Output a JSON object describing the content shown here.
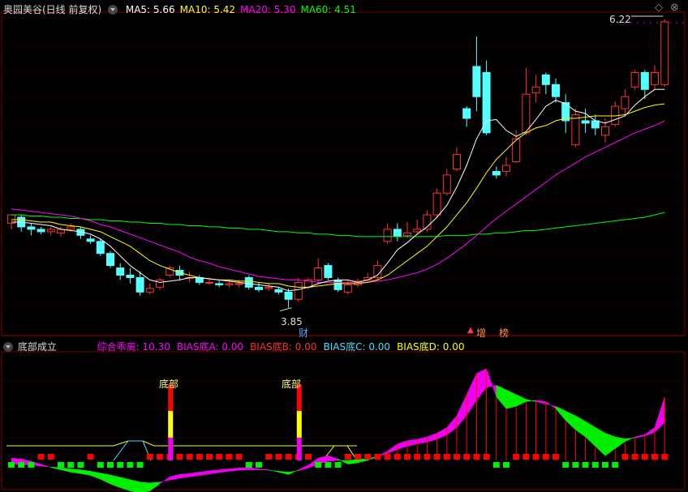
{
  "header": {
    "stock_title": "奥园美谷(日线 前复权)",
    "ma": [
      {
        "label": "MA5: 5.66",
        "color": "#ffffff"
      },
      {
        "label": "MA10: 5.42",
        "color": "#ffff00"
      },
      {
        "label": "MA20: 5.30",
        "color": "#ff00ff"
      },
      {
        "label": "MA60: 4.51",
        "color": "#00ff00"
      }
    ],
    "corner_up": "◇",
    "corner_close": "⊗"
  },
  "price_labels": {
    "high": "6.22",
    "low": "3.85",
    "cai": "财",
    "zeng": "增",
    "rong": "榜"
  },
  "indicator": {
    "title": "底部成立",
    "values": [
      {
        "label": "综合乖离: 10.30",
        "color": "#ff00ff"
      },
      {
        "label": "BIAS底A: 0.00",
        "color": "#ff00ff"
      },
      {
        "label": "BIAS底B: 0.00",
        "color": "#ff3030"
      },
      {
        "label": "BIAS底C: 0.00",
        "color": "#40e0ff"
      },
      {
        "label": "BIAS底D: 0.00",
        "color": "#ffff00"
      }
    ],
    "signal_label": "底部"
  },
  "colors": {
    "up": "#ff3232",
    "down": "#54ffff",
    "ma5": "#ffffff",
    "ma10": "#ffff00",
    "ma20": "#ff00ff",
    "ma60": "#00ff00",
    "grid": "#7a0000",
    "green": "#00ee00",
    "magenta": "#ee00ee",
    "red": "#ff0000",
    "yellow": "#ffff00"
  },
  "chart_data": {
    "type": "candlestick",
    "ylim": [
      3.7,
      6.3
    ],
    "candles": [
      [
        4.55,
        4.62,
        4.58,
        4.5
      ],
      [
        4.6,
        4.52,
        4.62,
        4.48
      ],
      [
        4.52,
        4.5,
        4.55,
        4.45
      ],
      [
        4.5,
        4.48,
        4.52,
        4.46
      ],
      [
        4.48,
        4.5,
        4.52,
        4.45
      ],
      [
        4.47,
        4.5,
        4.52,
        4.44
      ],
      [
        4.5,
        4.52,
        4.55,
        4.48
      ],
      [
        4.5,
        4.45,
        4.52,
        4.42
      ],
      [
        4.42,
        4.4,
        4.45,
        4.38
      ],
      [
        4.4,
        4.3,
        4.42,
        4.28
      ],
      [
        4.3,
        4.2,
        4.32,
        4.18
      ],
      [
        4.18,
        4.12,
        4.22,
        4.08
      ],
      [
        4.12,
        4.1,
        4.18,
        4.05
      ],
      [
        4.1,
        3.98,
        4.15,
        3.95
      ],
      [
        3.98,
        4.01,
        4.05,
        3.96
      ],
      [
        4.02,
        4.08,
        4.1,
        4.0
      ],
      [
        4.12,
        4.18,
        4.2,
        4.1
      ],
      [
        4.16,
        4.12,
        4.2,
        4.08
      ],
      [
        4.1,
        4.1,
        4.15,
        4.06
      ],
      [
        4.1,
        4.06,
        4.12,
        4.04
      ],
      [
        4.06,
        4.06,
        4.1,
        4.04
      ],
      [
        4.05,
        4.04,
        4.08,
        4.02
      ],
      [
        4.04,
        4.05,
        4.08,
        4.02
      ],
      [
        4.05,
        4.05,
        4.08,
        4.02
      ],
      [
        4.1,
        4.02,
        4.12,
        4.0
      ],
      [
        4.02,
        4.0,
        4.06,
        3.98
      ],
      [
        4.01,
        4.02,
        4.05,
        3.99
      ],
      [
        4.0,
        3.98,
        4.02,
        3.96
      ],
      [
        3.98,
        3.92,
        4.01,
        3.85
      ],
      [
        3.92,
        4.06,
        4.1,
        3.9
      ],
      [
        4.02,
        4.08,
        4.1,
        4.0
      ],
      [
        4.08,
        4.18,
        4.26,
        4.05
      ],
      [
        4.2,
        4.1,
        4.22,
        4.08
      ],
      [
        4.08,
        4.0,
        4.1,
        3.98
      ],
      [
        3.98,
        4.04,
        4.08,
        3.96
      ],
      [
        4.04,
        4.07,
        4.09,
        4.02
      ],
      [
        4.08,
        4.1,
        4.14,
        4.06
      ],
      [
        4.1,
        4.2,
        4.24,
        4.08
      ],
      [
        4.4,
        4.5,
        4.55,
        4.38
      ],
      [
        4.5,
        4.44,
        4.55,
        4.4
      ],
      [
        4.45,
        4.47,
        4.56,
        4.43
      ],
      [
        4.48,
        4.5,
        4.58,
        4.46
      ],
      [
        4.5,
        4.62,
        4.66,
        4.48
      ],
      [
        4.62,
        4.8,
        4.84,
        4.6
      ],
      [
        4.8,
        4.95,
        5.0,
        4.78
      ],
      [
        5.0,
        5.12,
        5.18,
        4.98
      ],
      [
        5.5,
        5.42,
        5.52,
        5.35
      ],
      [
        5.85,
        5.6,
        6.1,
        5.48
      ],
      [
        5.8,
        5.3,
        5.9,
        5.28
      ],
      [
        4.98,
        4.95,
        5.02,
        4.92
      ],
      [
        4.98,
        5.03,
        5.1,
        4.94
      ],
      [
        5.06,
        5.25,
        5.32,
        5.05
      ],
      [
        5.3,
        5.62,
        5.84,
        5.28
      ],
      [
        5.63,
        5.68,
        5.78,
        5.55
      ],
      [
        5.78,
        5.7,
        5.8,
        5.62
      ],
      [
        5.7,
        5.6,
        5.75,
        5.55
      ],
      [
        5.55,
        5.4,
        5.62,
        5.3
      ],
      [
        5.2,
        5.45,
        5.5,
        5.18
      ],
      [
        5.4,
        5.38,
        5.5,
        5.3
      ],
      [
        5.4,
        5.34,
        5.45,
        5.28
      ],
      [
        5.28,
        5.35,
        5.42,
        5.22
      ],
      [
        5.37,
        5.52,
        5.56,
        5.35
      ],
      [
        5.5,
        5.6,
        5.66,
        5.45
      ],
      [
        5.68,
        5.8,
        5.82,
        5.66
      ],
      [
        5.8,
        5.66,
        5.82,
        5.58
      ],
      [
        5.7,
        5.8,
        5.86,
        5.66
      ],
      [
        5.7,
        6.22,
        6.24,
        5.68
      ]
    ],
    "ma5": [
      4.56,
      4.56,
      4.55,
      4.54,
      4.53,
      4.5,
      4.49,
      4.48,
      4.46,
      4.42,
      4.36,
      4.28,
      4.2,
      4.14,
      4.08,
      4.06,
      4.07,
      4.08,
      4.1,
      4.1,
      4.09,
      4.08,
      4.07,
      4.06,
      4.05,
      4.04,
      4.03,
      4.02,
      3.99,
      4.0,
      4.02,
      4.05,
      4.07,
      4.08,
      4.08,
      4.06,
      4.08,
      4.12,
      4.22,
      4.33,
      4.39,
      4.46,
      4.52,
      4.6,
      4.7,
      4.85,
      5.03,
      5.25,
      5.4,
      5.41,
      5.32,
      5.27,
      5.31,
      5.41,
      5.52,
      5.57,
      5.54,
      5.48,
      5.46,
      5.4,
      5.38,
      5.41,
      5.44,
      5.53,
      5.6,
      5.66,
      5.66
    ],
    "ma10": [
      4.58,
      4.58,
      4.57,
      4.56,
      4.56,
      4.54,
      4.53,
      4.52,
      4.5,
      4.48,
      4.44,
      4.4,
      4.36,
      4.3,
      4.24,
      4.2,
      4.17,
      4.14,
      4.12,
      4.1,
      4.09,
      4.08,
      4.08,
      4.07,
      4.07,
      4.06,
      4.05,
      4.05,
      4.03,
      4.02,
      4.02,
      4.03,
      4.04,
      4.05,
      4.05,
      4.05,
      4.06,
      4.08,
      4.12,
      4.18,
      4.24,
      4.3,
      4.36,
      4.44,
      4.52,
      4.62,
      4.72,
      4.84,
      4.97,
      5.08,
      5.16,
      5.24,
      5.3,
      5.34,
      5.36,
      5.4,
      5.42,
      5.42,
      5.43,
      5.44,
      5.44,
      5.44,
      5.45,
      5.48,
      5.51,
      5.53,
      5.54
    ],
    "ma20": [
      4.67,
      4.66,
      4.65,
      4.64,
      4.63,
      4.62,
      4.61,
      4.59,
      4.57,
      4.54,
      4.52,
      4.49,
      4.46,
      4.43,
      4.4,
      4.37,
      4.34,
      4.31,
      4.27,
      4.24,
      4.22,
      4.19,
      4.17,
      4.15,
      4.13,
      4.11,
      4.1,
      4.09,
      4.08,
      4.08,
      4.07,
      4.06,
      4.06,
      4.06,
      4.06,
      4.06,
      4.06,
      4.07,
      4.08,
      4.1,
      4.12,
      4.14,
      4.17,
      4.21,
      4.26,
      4.32,
      4.38,
      4.45,
      4.52,
      4.59,
      4.65,
      4.71,
      4.77,
      4.83,
      4.89,
      4.95,
      5.0,
      5.05,
      5.1,
      5.14,
      5.18,
      5.22,
      5.26,
      5.3,
      5.33,
      5.36,
      5.4
    ],
    "ma60": [
      4.62,
      4.62,
      4.61,
      4.61,
      4.6,
      4.6,
      4.59,
      4.59,
      4.58,
      4.58,
      4.57,
      4.57,
      4.56,
      4.56,
      4.55,
      4.55,
      4.54,
      4.54,
      4.53,
      4.53,
      4.52,
      4.52,
      4.51,
      4.51,
      4.5,
      4.5,
      4.49,
      4.48,
      4.48,
      4.47,
      4.47,
      4.46,
      4.46,
      4.45,
      4.45,
      4.44,
      4.44,
      4.44,
      4.44,
      4.44,
      4.44,
      4.44,
      4.44,
      4.44,
      4.45,
      4.45,
      4.45,
      4.46,
      4.46,
      4.47,
      4.47,
      4.48,
      4.49,
      4.49,
      4.5,
      4.51,
      4.52,
      4.53,
      4.54,
      4.55,
      4.56,
      4.57,
      4.58,
      4.59,
      4.6,
      4.62,
      4.64
    ],
    "bias": [
      0.5,
      0.3,
      -0.2,
      -0.8,
      -1.5,
      -2.0,
      -2.5,
      -2.8,
      -3.2,
      -4.0,
      -5.0,
      -5.8,
      -6.5,
      -7.0,
      -6.5,
      -5.0,
      -3.5,
      -3.0,
      -2.8,
      -2.5,
      -2.2,
      -2.0,
      -1.8,
      -1.6,
      -1.5,
      -1.8,
      -2.0,
      -2.5,
      -3.0,
      -2.0,
      -1.0,
      0.5,
      1.0,
      0.3,
      -0.8,
      -0.5,
      0.0,
      0.8,
      2.0,
      3.5,
      4.2,
      4.5,
      5.0,
      5.8,
      7.0,
      9.5,
      14.0,
      18.5,
      19.5,
      13.5,
      11.0,
      11.5,
      12.5,
      12.8,
      12.5,
      11.0,
      8.5,
      6.5,
      5.0,
      3.0,
      1.0,
      2.5,
      4.0,
      5.0,
      5.5,
      7.0,
      13.5
    ],
    "ma_bias": [
      -0.8,
      -0.9,
      -1.0,
      -1.2,
      -1.4,
      -1.6,
      -1.8,
      -2.0,
      -2.3,
      -2.7,
      -3.1,
      -3.6,
      -4.1,
      -4.6,
      -4.8,
      -4.6,
      -4.2,
      -3.8,
      -3.5,
      -3.2,
      -2.9,
      -2.6,
      -2.3,
      -2.1,
      -2.0,
      -2.0,
      -2.1,
      -2.3,
      -2.5,
      -2.2,
      -1.6,
      -0.8,
      -0.2,
      0.0,
      0.0,
      0.2,
      0.4,
      0.8,
      1.5,
      2.3,
      3.0,
      3.5,
      3.9,
      4.5,
      5.4,
      7.0,
      9.6,
      12.8,
      15.5,
      16.0,
      15.0,
      14.0,
      13.0,
      12.5,
      12.0,
      11.5,
      10.5,
      9.5,
      8.3,
      7.0,
      5.8,
      5.0,
      4.6,
      4.8,
      5.2,
      6.0,
      8.0
    ],
    "bar_sign": [
      -1,
      -1,
      -1,
      1,
      1,
      -1,
      -1,
      -1,
      1,
      -1,
      -1,
      -1,
      -1,
      -1,
      1,
      1,
      1,
      1,
      1,
      1,
      1,
      1,
      1,
      1,
      -1,
      -1,
      1,
      1,
      1,
      1,
      1,
      -1,
      -1,
      -1,
      1,
      1,
      1,
      1,
      1,
      1,
      1,
      1,
      1,
      1,
      1,
      1,
      1,
      1,
      1,
      -1,
      -1,
      1,
      1,
      1,
      1,
      1,
      -1,
      -1,
      -1,
      -1,
      -1,
      -1,
      1,
      1,
      1,
      1,
      1
    ],
    "bottom_signals": [
      16,
      29
    ]
  }
}
